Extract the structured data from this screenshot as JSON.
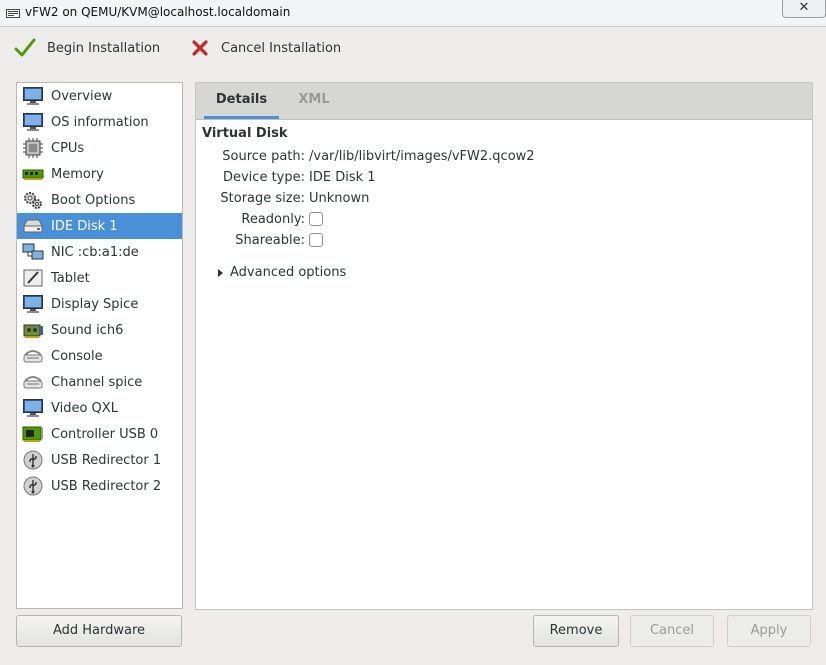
{
  "window": {
    "title": "vFW2 on QEMU/KVM@localhost.localdomain",
    "close_glyph": "✕"
  },
  "toolbar": {
    "begin_label": "Begin Installation",
    "cancel_label": "Cancel Installation"
  },
  "sidebar": {
    "items": [
      {
        "label": "Overview",
        "icon": "monitor-icon"
      },
      {
        "label": "OS information",
        "icon": "monitor-icon"
      },
      {
        "label": "CPUs",
        "icon": "cpu-icon"
      },
      {
        "label": "Memory",
        "icon": "memory-icon"
      },
      {
        "label": "Boot Options",
        "icon": "gear-icon"
      },
      {
        "label": "IDE Disk 1",
        "icon": "disk-icon",
        "selected": true
      },
      {
        "label": "NIC :cb:a1:de",
        "icon": "network-icon"
      },
      {
        "label": "Tablet",
        "icon": "tablet-icon"
      },
      {
        "label": "Display Spice",
        "icon": "monitor-icon"
      },
      {
        "label": "Sound ich6",
        "icon": "sound-card-icon"
      },
      {
        "label": "Console",
        "icon": "console-icon"
      },
      {
        "label": "Channel spice",
        "icon": "console-icon"
      },
      {
        "label": "Video QXL",
        "icon": "monitor-icon"
      },
      {
        "label": "Controller USB 0",
        "icon": "controller-icon"
      },
      {
        "label": "USB Redirector 1",
        "icon": "usb-icon"
      },
      {
        "label": "USB Redirector 2",
        "icon": "usb-icon"
      }
    ]
  },
  "tabs": {
    "details": "Details",
    "xml": "XML"
  },
  "details": {
    "section_title": "Virtual Disk",
    "source_path_label": "Source path:",
    "source_path": "/var/lib/libvirt/images/vFW2.qcow2",
    "device_type_label": "Device type:",
    "device_type": "IDE Disk 1",
    "storage_size_label": "Storage size:",
    "storage_size": "Unknown",
    "readonly_label": "Readonly:",
    "shareable_label": "Shareable:",
    "advanced_label": "Advanced options"
  },
  "buttons": {
    "add_hardware": "Add Hardware",
    "remove": "Remove",
    "cancel": "Cancel",
    "apply": "Apply"
  },
  "colors": {
    "selection": "#4a90d9",
    "window_bg": "#edeceb"
  }
}
